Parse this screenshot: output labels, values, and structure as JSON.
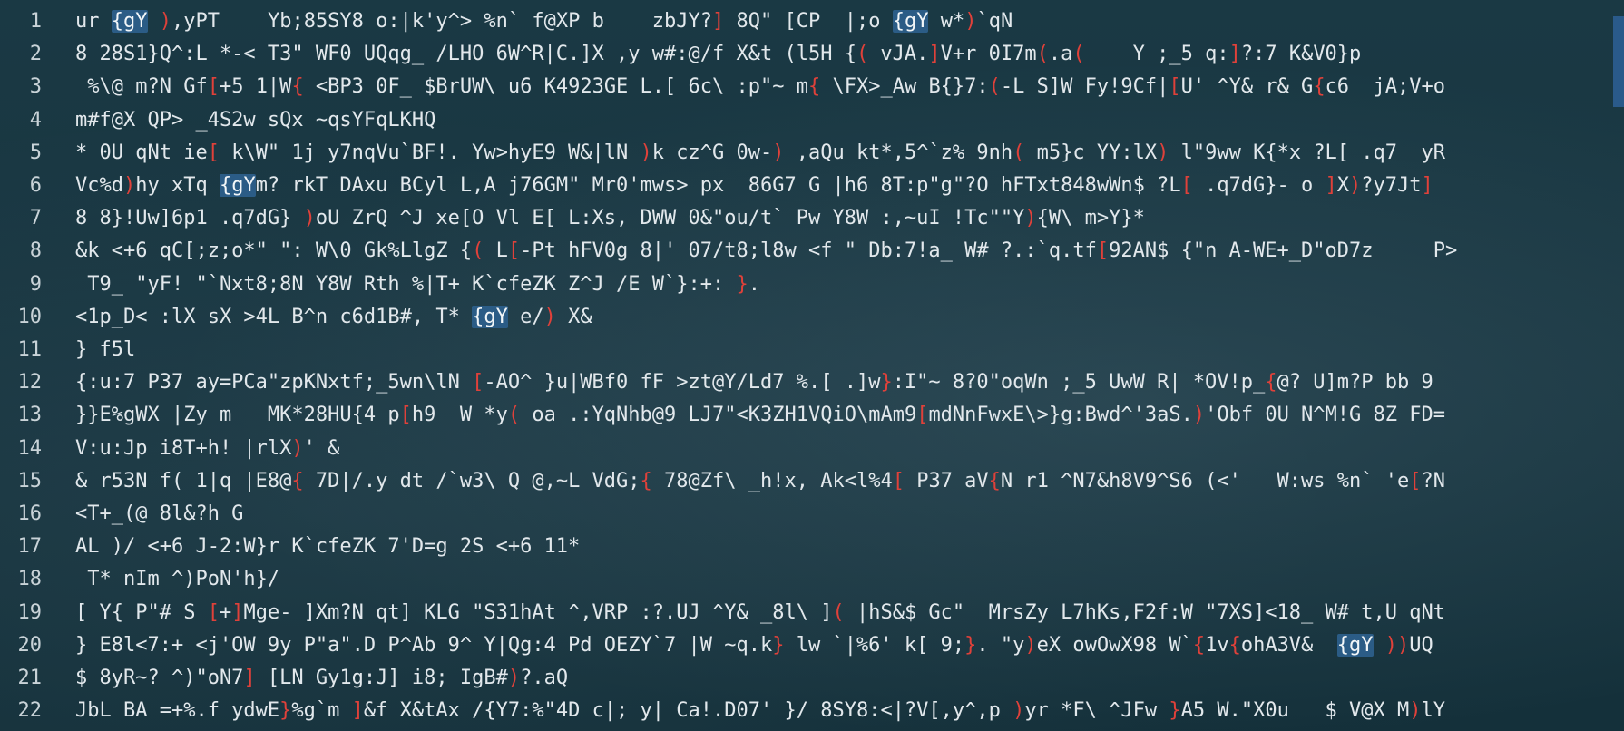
{
  "line_numbers": [
    "1",
    "2",
    "3",
    "4",
    "5",
    "6",
    "7",
    "8",
    "9",
    "10",
    "11",
    "12",
    "13",
    "14",
    "15",
    "16",
    "17",
    "18",
    "19",
    "20",
    "21",
    "22"
  ],
  "lines": [
    [
      [
        "t",
        "ur "
      ],
      [
        "h",
        "{gY"
      ],
      [
        "t",
        " "
      ],
      [
        "b",
        ")"
      ],
      [
        "t",
        ",yPT    Yb;85SY8 o:|k'y^> %n` f@XP b    zbJY?"
      ],
      [
        "b",
        "]"
      ],
      [
        "t",
        " 8Q\" [CP  |;o "
      ],
      [
        "h",
        "{gY"
      ],
      [
        "t",
        " w*"
      ],
      [
        "b",
        ")"
      ],
      [
        "t",
        "`qN"
      ]
    ],
    [
      [
        "t",
        "8 28S1}Q^:L *-< T3\" WF0 UQqg_ /LHO 6W^R|C.]X ,y w#:@/f X&t (l5H {"
      ],
      [
        "b",
        "("
      ],
      [
        "t",
        " vJA."
      ],
      [
        "b",
        "]"
      ],
      [
        "t",
        "V+r 0I7m"
      ],
      [
        "b",
        "("
      ],
      [
        "t",
        ".a"
      ],
      [
        "b",
        "("
      ],
      [
        "t",
        "    Y ;_5 q:"
      ],
      [
        "b",
        "]"
      ],
      [
        "t",
        "?:7 K&V0}p"
      ]
    ],
    [
      [
        "t",
        " %\\@ m?N Gf"
      ],
      [
        "b",
        "["
      ],
      [
        "t",
        "+5 1|W"
      ],
      [
        "b",
        "{"
      ],
      [
        "t",
        " <BP3 0F_ $BrUW\\ u6 K4923GE L.[ 6c\\ :p\"~ m"
      ],
      [
        "b",
        "{"
      ],
      [
        "t",
        " \\FX>_Aw B{}7:"
      ],
      [
        "b",
        "("
      ],
      [
        "t",
        "-L S]W Fy!9Cf|"
      ],
      [
        "b",
        "["
      ],
      [
        "t",
        "U' ^Y& r& G"
      ],
      [
        "b",
        "{"
      ],
      [
        "t",
        "c6  jA;V+o"
      ]
    ],
    [
      [
        "t",
        "m#f@X QP> _4S2w sQx ~qsYFqLKHQ"
      ]
    ],
    [
      [
        "t",
        "* 0U qNt ie"
      ],
      [
        "b",
        "["
      ],
      [
        "t",
        " k\\W\" 1j y7nqVu`BF!. Yw>hyE9 W&|lN "
      ],
      [
        "b",
        ")"
      ],
      [
        "t",
        "k cz^G 0w-"
      ],
      [
        "b",
        ")"
      ],
      [
        "t",
        " ,aQu kt*,5^`z% 9nh"
      ],
      [
        "b",
        "("
      ],
      [
        "t",
        " m5}c YY:lX"
      ],
      [
        "b",
        ")"
      ],
      [
        "t",
        " l\"9ww K{*x ?L[ .q7  yR"
      ]
    ],
    [
      [
        "t",
        "Vc%d"
      ],
      [
        "b",
        ")"
      ],
      [
        "t",
        "hy xTq "
      ],
      [
        "h",
        "{gY"
      ],
      [
        "t",
        "m? rkT DAxu BCyl L,A j76GM\" Mr0'mws> px  86G7 G |h6 8T:p\"g\"?O hFTxt848wWn$ ?L"
      ],
      [
        "b",
        "["
      ],
      [
        "t",
        " .q7dG}- o "
      ],
      [
        "b",
        "]"
      ],
      [
        "t",
        "X"
      ],
      [
        "b",
        ")"
      ],
      [
        "t",
        "?y7Jt"
      ],
      [
        "b",
        "]"
      ]
    ],
    [
      [
        "t",
        "8 8}!Uw]6p1 .q7dG} "
      ],
      [
        "b",
        ")"
      ],
      [
        "t",
        "oU ZrQ ^J xe[O Vl E[ L:Xs, DWW 0&\"ou/t` Pw Y8W :,~uI !Tc\"\"Y"
      ],
      [
        "b",
        ")"
      ],
      [
        "t",
        "{W\\ m>Y}*"
      ]
    ],
    [
      [
        "t",
        "&k <+6 qC[;z;o*\" \": W\\0 Gk%LlgZ {"
      ],
      [
        "b",
        "("
      ],
      [
        "t",
        " L"
      ],
      [
        "b",
        "["
      ],
      [
        "t",
        "-Pt hFV0g 8|' 07/t8;l8w <f \" Db:7!a_ W# ?.:`q.tf"
      ],
      [
        "b",
        "["
      ],
      [
        "t",
        "92AN$ {\"n A-WE+_D\"oD7z     P>"
      ]
    ],
    [
      [
        "t",
        " T9_ \"yF! \"`Nxt8;8N Y8W Rth %|T+ K`cfeZK Z^J /E W`}:+: "
      ],
      [
        "b",
        "}"
      ],
      [
        "t",
        "."
      ]
    ],
    [
      [
        "t",
        "<1p_D< :lX sX >4L B^n c6d1B#, T* "
      ],
      [
        "h",
        "{gY"
      ],
      [
        "t",
        " e/"
      ],
      [
        "b",
        ")"
      ],
      [
        "t",
        " X&"
      ]
    ],
    [
      [
        "t",
        "} f5l"
      ]
    ],
    [
      [
        "t",
        "{:u:7 P37 ay=PCa\"zpKNxtf;_5wn\\lN "
      ],
      [
        "b",
        "["
      ],
      [
        "t",
        "-AO^ }u|WBf0 fF >zt@Y/Ld7 %.[ .]w"
      ],
      [
        "b",
        "}"
      ],
      [
        "t",
        ":I\"~ 8?0\"oqWn ;_5 UwW R| *OV!p_"
      ],
      [
        "b",
        "{"
      ],
      [
        "t",
        "@? U]m?P bb 9"
      ]
    ],
    [
      [
        "t",
        "}}E%gWX |Zy m   MK*28HU{4 p"
      ],
      [
        "b",
        "["
      ],
      [
        "t",
        "h9  W *y"
      ],
      [
        "b",
        "("
      ],
      [
        "t",
        " oa .:YqNhb@9 LJ7\"<K3ZH1VQiO\\mAm9"
      ],
      [
        "b",
        "["
      ],
      [
        "t",
        "mdNnFwxE\\>}g:Bwd^'3aS."
      ],
      [
        "b",
        ")"
      ],
      [
        "t",
        "'Obf 0U N^M!G 8Z FD="
      ]
    ],
    [
      [
        "t",
        "V:u:Jp i8T+h! |rlX"
      ],
      [
        "b",
        ")"
      ],
      [
        "t",
        "' &"
      ]
    ],
    [
      [
        "t",
        "& r53N f( 1|q |E8@"
      ],
      [
        "b",
        "{"
      ],
      [
        "t",
        " 7D|/.y dt /`w3\\ Q @,~L VdG;"
      ],
      [
        "b",
        "{"
      ],
      [
        "t",
        " 78@Zf\\ _h!x, Ak<l%4"
      ],
      [
        "b",
        "["
      ],
      [
        "t",
        " P37 aV"
      ],
      [
        "b",
        "{"
      ],
      [
        "t",
        "N r1 ^N7&h8V9^S6 (<'   W:ws %n` 'e"
      ],
      [
        "b",
        "["
      ],
      [
        "t",
        "?N"
      ]
    ],
    [
      [
        "t",
        "<T+_(@ 8l&?h G"
      ]
    ],
    [
      [
        "t",
        "AL )/ <+6 J-2:W}r K`cfeZK 7'D=g 2S <+6 11*"
      ]
    ],
    [
      [
        "t",
        " T* nIm ^)PoN'h}/"
      ]
    ],
    [
      [
        "t",
        "[ Y{ P\"# S "
      ],
      [
        "b",
        "["
      ],
      [
        "t",
        "+"
      ],
      [
        "b",
        "]"
      ],
      [
        "t",
        "Mge- ]Xm?N qt] KLG \"S31hAt ^,VRP :?.UJ ^Y& _8l\\ ]"
      ],
      [
        "b",
        "("
      ],
      [
        "t",
        " |hS&$ Gc\"  MrsZy L7hKs,F2f:W \"7XS]<18_ W# t,U qNt"
      ]
    ],
    [
      [
        "t",
        "} E8l<7:+ <j'OW 9y P\"a\".D P^Ab 9^ Y|Qg:4 Pd OEZY`7 |W ~q.k"
      ],
      [
        "b",
        "}"
      ],
      [
        "t",
        " lw `|%6' k[ 9;"
      ],
      [
        "b",
        "}"
      ],
      [
        "t",
        ". \"y"
      ],
      [
        "b",
        ")"
      ],
      [
        "t",
        "eX owOwX98 W`"
      ],
      [
        "b",
        "{"
      ],
      [
        "t",
        "1v"
      ],
      [
        "b",
        "{"
      ],
      [
        "t",
        "ohA3V&  "
      ],
      [
        "h",
        "{gY"
      ],
      [
        "t",
        " "
      ],
      [
        "b",
        "))"
      ],
      [
        "t",
        "UQ"
      ]
    ],
    [
      [
        "t",
        "$ 8yR~? ^)\"oN7"
      ],
      [
        "b",
        "]"
      ],
      [
        "t",
        " [LN Gy1g:J] i8; IgB#"
      ],
      [
        "b",
        ")"
      ],
      [
        "t",
        "?.aQ"
      ]
    ],
    [
      [
        "t",
        "JbL BA =+%.f ydwE"
      ],
      [
        "b",
        "}"
      ],
      [
        "t",
        "%g`m "
      ],
      [
        "b",
        "]"
      ],
      [
        "t",
        "&f X&tAx /{Y7:%\"4D c|; y| Ca!.D07' }/ 8SY8:<|?V[,y^,p "
      ],
      [
        "b",
        ")"
      ],
      [
        "t",
        "yr *F\\ ^JFw "
      ],
      [
        "b",
        "}"
      ],
      [
        "t",
        "A5 W.\"X0u   $ V@X M"
      ],
      [
        "b",
        ")"
      ],
      [
        "t",
        "lY"
      ]
    ]
  ],
  "colors": {
    "background": "#17333d",
    "text": "#e2e8ec",
    "bracket": "#e0413a",
    "highlight": "#2b5c86",
    "line_number": "#c9d3d8"
  }
}
